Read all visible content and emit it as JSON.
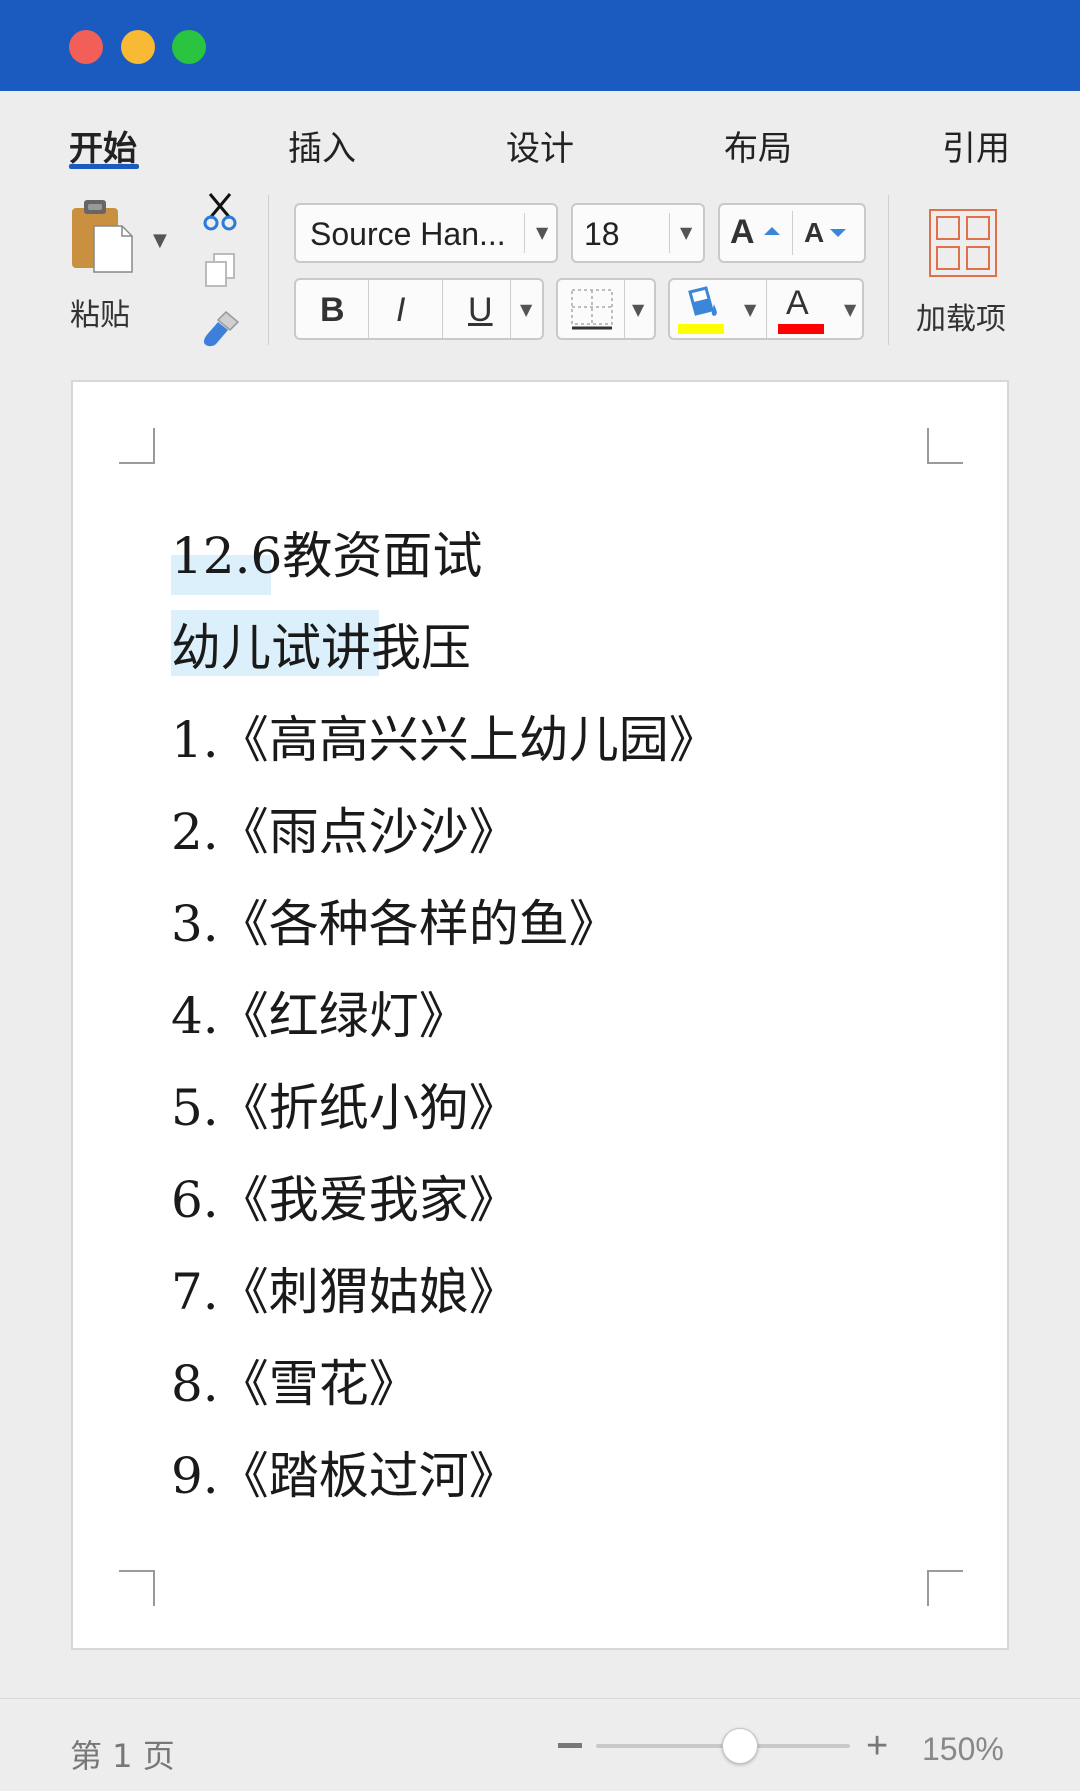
{
  "window": {
    "traffic_lights": [
      {
        "name": "close",
        "color": "#f25f58"
      },
      {
        "name": "minimize",
        "color": "#f8b935"
      },
      {
        "name": "zoom",
        "color": "#29c440"
      }
    ],
    "titlebar_color": "#1b5bbf"
  },
  "tabs": [
    {
      "label": "开始",
      "active": true
    },
    {
      "label": "插入",
      "active": false
    },
    {
      "label": "设计",
      "active": false
    },
    {
      "label": "布局",
      "active": false
    },
    {
      "label": "引用",
      "active": false
    }
  ],
  "ribbon": {
    "paste_label": "粘贴",
    "font_name": "Source Han...",
    "font_size": "18",
    "grow_font": "A",
    "shrink_font": "A",
    "bold": "B",
    "italic": "I",
    "underline": "U",
    "font_color_glyph": "A",
    "highlight_color": "#ffff00",
    "font_color": "#ff0000",
    "addins_label": "加载项",
    "icons": [
      "paste-icon",
      "cut-icon",
      "copy-icon",
      "format-painter-icon",
      "borders-icon",
      "highlight-icon",
      "font-color-icon",
      "addins-icon"
    ]
  },
  "document": {
    "lines": [
      "12.6教资面试",
      "幼儿试讲我压",
      "1.《高高兴兴上幼儿园》",
      "2.《雨点沙沙》",
      "3.《各种各样的鱼》",
      "4.《红绿灯》",
      "5.《折纸小狗》",
      "6.《我爱我家》",
      "7.《刺猬姑娘》",
      "8.《雪花》",
      "9.《踏板过河》"
    ],
    "highlight_color": "#dcf0fb"
  },
  "status": {
    "page_indicator": "第 1 页",
    "zoom_minus": "−",
    "zoom_plus": "+",
    "zoom_value": "150%"
  }
}
